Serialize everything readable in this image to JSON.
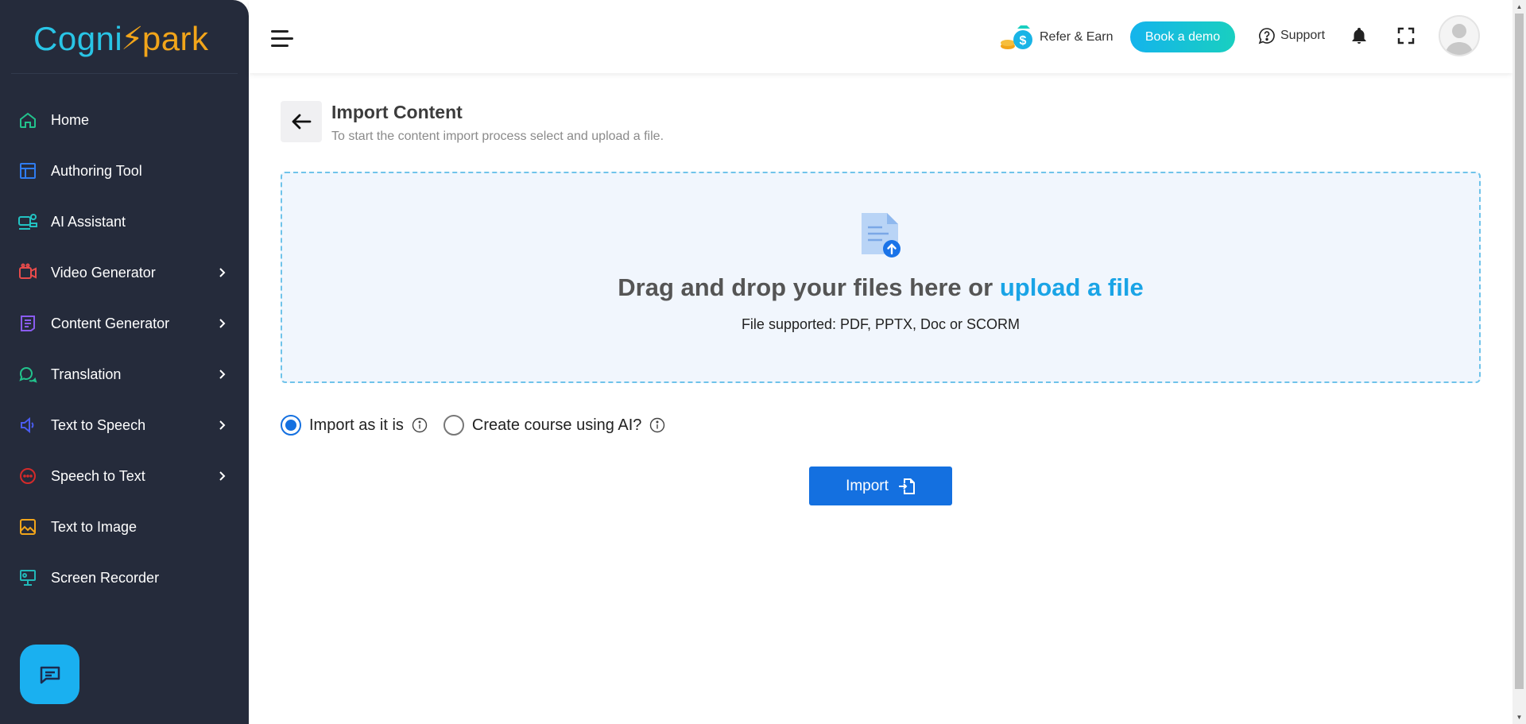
{
  "brand": {
    "logo_part1": "Cogni",
    "logo_part2": "park"
  },
  "sidebar": {
    "items": [
      {
        "label": "Home",
        "icon": "home-icon",
        "color": "#22c28c",
        "has_submenu": false
      },
      {
        "label": "Authoring Tool",
        "icon": "layout-icon",
        "color": "#2f7cf0",
        "has_submenu": false
      },
      {
        "label": "AI Assistant",
        "icon": "indra-assistant-icon",
        "color": "#22c2c2",
        "has_submenu": false
      },
      {
        "label": "Video Generator",
        "icon": "video-icon",
        "color": "#e84b4b",
        "has_submenu": true
      },
      {
        "label": "Content Generator",
        "icon": "document-icon",
        "color": "#8a5cf0",
        "has_submenu": true
      },
      {
        "label": "Translation",
        "icon": "chat-bubbles-icon",
        "color": "#22c28c",
        "has_submenu": true
      },
      {
        "label": "Text to Speech",
        "icon": "speaker-icon",
        "color": "#4a5cf0",
        "has_submenu": true
      },
      {
        "label": "Speech to Text",
        "icon": "speech-bubble-icon",
        "color": "#d42a2a",
        "has_submenu": true
      },
      {
        "label": "Text to Image",
        "icon": "image-icon",
        "color": "#f2a51a",
        "has_submenu": false
      },
      {
        "label": "Screen Recorder",
        "icon": "monitor-icon",
        "color": "#22b8b8",
        "has_submenu": false
      }
    ]
  },
  "header": {
    "refer_label": "Refer & Earn",
    "demo_label": "Book a demo",
    "support_label": "Support"
  },
  "main": {
    "title": "Import Content",
    "subtitle": "To start the content import process select and upload a file.",
    "dropzone": {
      "text_before": "Drag and drop your files here or ",
      "link_text": "upload a file",
      "supported": "File supported: PDF, PPTX, Doc or SCORM"
    },
    "options": [
      {
        "label": "Import as it is",
        "checked": true
      },
      {
        "label": "Create course using AI?",
        "checked": false
      }
    ],
    "import_label": "Import"
  },
  "colors": {
    "sidebar_bg": "#252b3b",
    "primary": "#1470e0",
    "accent": "#1aa4e6"
  }
}
